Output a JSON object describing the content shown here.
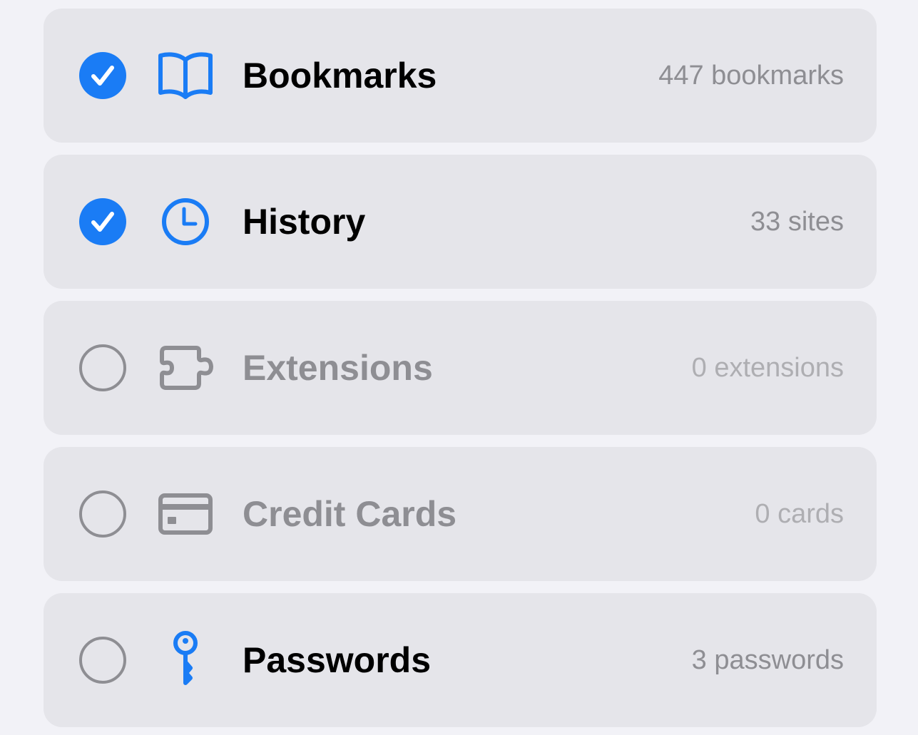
{
  "colors": {
    "accent": "#1a7cf5",
    "disabled": "#8e8e93",
    "row_bg": "#e5e5ea",
    "page_bg": "#f2f2f7"
  },
  "items": [
    {
      "label": "Bookmarks",
      "count": "447 bookmarks",
      "checked": true,
      "enabled": true,
      "icon": "book-icon"
    },
    {
      "label": "History",
      "count": "33 sites",
      "checked": true,
      "enabled": true,
      "icon": "clock-icon"
    },
    {
      "label": "Extensions",
      "count": "0 extensions",
      "checked": false,
      "enabled": false,
      "icon": "puzzle-piece-icon"
    },
    {
      "label": "Credit Cards",
      "count": "0 cards",
      "checked": false,
      "enabled": false,
      "icon": "credit-card-icon"
    },
    {
      "label": "Passwords",
      "count": "3 passwords",
      "checked": false,
      "enabled": true,
      "icon": "key-icon"
    }
  ]
}
